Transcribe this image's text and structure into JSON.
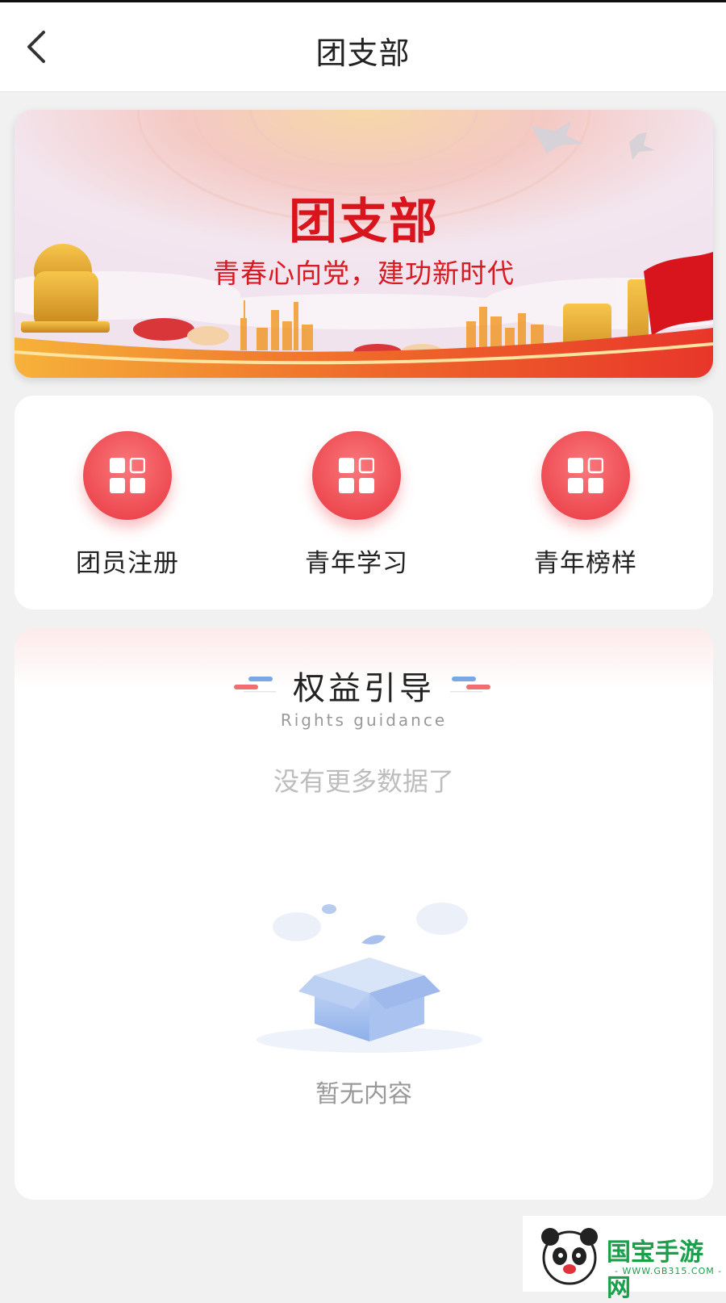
{
  "header": {
    "title": "团支部",
    "back_icon": "chevron-left-icon"
  },
  "banner": {
    "title": "团支部",
    "subtitle": "青春心向党，建功新时代",
    "title_color": "#d9141c"
  },
  "quick_menu": {
    "items": [
      {
        "label": "团员注册",
        "icon": "grid-apps-icon"
      },
      {
        "label": "青年学习",
        "icon": "grid-apps-icon"
      },
      {
        "label": "青年榜样",
        "icon": "grid-apps-icon"
      }
    ],
    "accent": "#ee4a52"
  },
  "rights": {
    "title": "权益引导",
    "subtitle": "Rights guidance",
    "no_more": "没有更多数据了",
    "empty_text": "暂无内容",
    "empty_icon": "empty-box-icon"
  },
  "watermark": {
    "name": "国宝手游网",
    "url": "- WWW.GB315.COM -"
  }
}
